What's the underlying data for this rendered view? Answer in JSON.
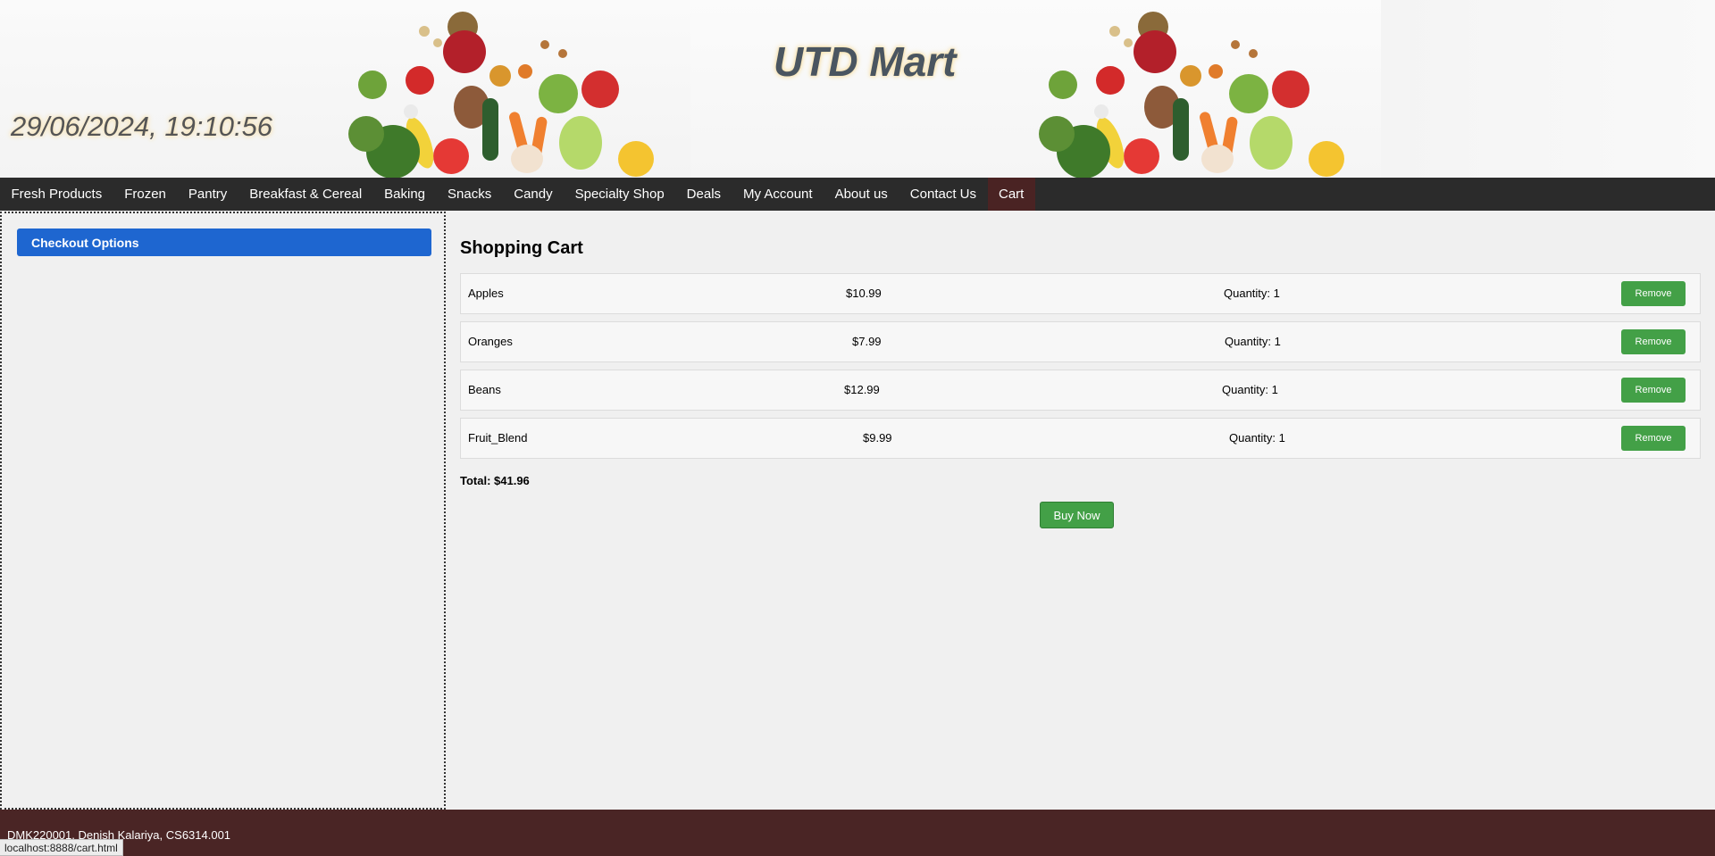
{
  "header": {
    "date_time": "29/06/2024, 19:10:56",
    "site_title": "UTD Mart",
    "banner_image_icon": "vegetables-banner-image"
  },
  "nav": {
    "items": [
      {
        "label": "Fresh Products"
      },
      {
        "label": "Frozen"
      },
      {
        "label": "Pantry"
      },
      {
        "label": "Breakfast & Cereal"
      },
      {
        "label": "Baking"
      },
      {
        "label": "Snacks"
      },
      {
        "label": "Candy"
      },
      {
        "label": "Specialty Shop"
      },
      {
        "label": "Deals"
      },
      {
        "label": "My Account"
      },
      {
        "label": "About us"
      },
      {
        "label": "Contact Us"
      },
      {
        "label": "Cart"
      }
    ],
    "active": "Cart"
  },
  "sidebar": {
    "checkout_label": "Checkout Options"
  },
  "cart": {
    "title": "Shopping Cart",
    "items": [
      {
        "name": "Apples",
        "price": "$10.99",
        "quantity": "Quantity: 1",
        "remove_label": "Remove"
      },
      {
        "name": "Oranges",
        "price": "$7.99",
        "quantity": "Quantity: 1",
        "remove_label": "Remove"
      },
      {
        "name": "Beans",
        "price": "$12.99",
        "quantity": "Quantity: 1",
        "remove_label": "Remove"
      },
      {
        "name": "Fruit_Blend",
        "price": "$9.99",
        "quantity": "Quantity: 1",
        "remove_label": "Remove"
      }
    ],
    "total": "Total: $41.96",
    "buy_label": "Buy Now"
  },
  "footer": {
    "credit": "DMK220001, Denish Kalariya, CS6314.001"
  },
  "status_bar": {
    "url": "localhost:8888/cart.html"
  },
  "colors": {
    "nav_bg": "#2b2b2b",
    "nav_active": "#4a2323",
    "checkout_blue": "#1e66d0",
    "button_green": "#43a047",
    "footer_bg": "#4a2525"
  }
}
